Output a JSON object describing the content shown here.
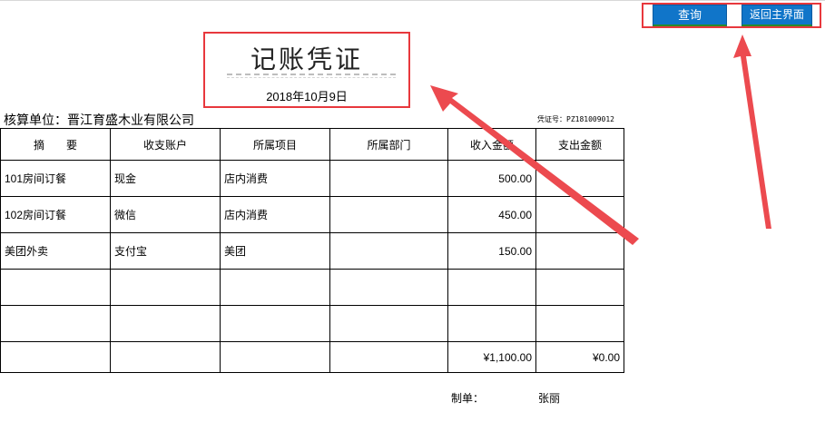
{
  "toolbar": {
    "query_label": "查询",
    "home_label": "返回主界面"
  },
  "voucher": {
    "title": "记账凭证",
    "date": "2018年10月9日",
    "unit": "核算单位：晋江育盛木业有限公司",
    "voucher_no": "凭证号：PZ181009012"
  },
  "table": {
    "headers": [
      "摘　　要",
      "收支账户",
      "所属项目",
      "所属部门",
      "收入金额",
      "支出金额"
    ],
    "rows": [
      [
        "101房间订餐",
        "现金",
        "店内消费",
        "",
        "500.00",
        ""
      ],
      [
        "102房间订餐",
        "微信",
        "店内消费",
        "",
        "450.00",
        ""
      ],
      [
        "美团外卖",
        "支付宝",
        "美团",
        "",
        "150.00",
        ""
      ],
      [
        "",
        "",
        "",
        "",
        "",
        ""
      ],
      [
        "",
        "",
        "",
        "",
        "",
        ""
      ]
    ],
    "totals": [
      "",
      "",
      "",
      "",
      "¥1,100.00",
      "¥0.00"
    ]
  },
  "footer": {
    "maker_label": "制单：",
    "maker_name": "张丽"
  },
  "colors": {
    "button": "#1075c9",
    "annotation": "#e8383d"
  }
}
